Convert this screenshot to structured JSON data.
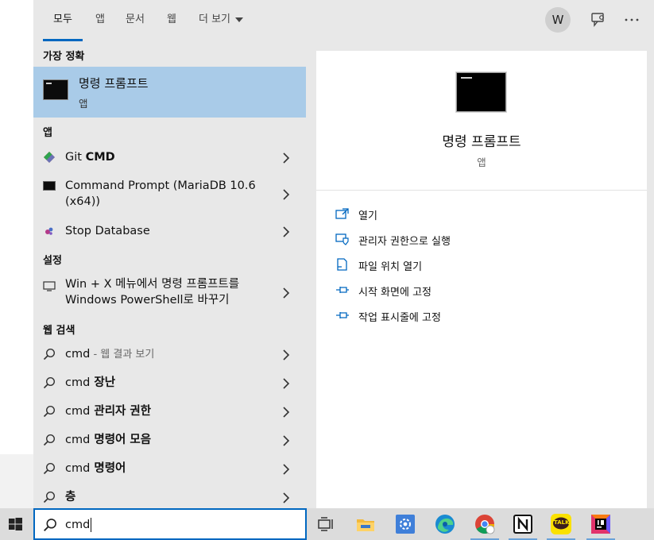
{
  "tabs": [
    {
      "label": "모두"
    },
    {
      "label": "앱"
    },
    {
      "label": "문서"
    },
    {
      "label": "웹"
    },
    {
      "label": "더 보기"
    }
  ],
  "header": {
    "avatar_letter": "W",
    "feedback_icon": "feedback-icon",
    "more_icon": "ellipsis-icon"
  },
  "list": {
    "best_match_header": "가장 정확",
    "best_match": {
      "title": "명령 프롬프트",
      "subtitle": "앱",
      "icon": "command-prompt-icon"
    },
    "apps_header": "앱",
    "apps": [
      {
        "prefix": "Git ",
        "bold": "CMD",
        "icon": "git-icon"
      },
      {
        "line1": "Command Prompt (MariaDB 10.6",
        "line2": "(x64))",
        "icon": "console-icon"
      },
      {
        "label": "Stop Database",
        "icon": "database-icon"
      }
    ],
    "settings_header": "설정",
    "settings": [
      {
        "line1": "Win + X 메뉴에서 명령 프롬프트를",
        "line2": "Windows PowerShell로 바꾸기",
        "icon": "monitor-icon"
      }
    ],
    "web_header": "웹 검색",
    "web": [
      {
        "term": "cmd",
        "suffix": " - 웹 결과 보기",
        "icon": "search-icon"
      },
      {
        "term": "cmd",
        "bold": " 장난",
        "icon": "search-icon"
      },
      {
        "term": "cmd",
        "bold": " 관리자 권한",
        "icon": "search-icon"
      },
      {
        "term": "cmd",
        "bold": " 명령어 모음",
        "icon": "search-icon"
      },
      {
        "term": "cmd",
        "bold": " 명령어",
        "icon": "search-icon"
      },
      {
        "term": "",
        "bold": "층",
        "icon": "search-icon"
      }
    ]
  },
  "preview": {
    "title": "명령 프롬프트",
    "subtitle": "앱",
    "actions": [
      {
        "label": "열기",
        "icon": "open-icon"
      },
      {
        "label": "관리자 권한으로 실행",
        "icon": "shield-icon"
      },
      {
        "label": "파일 위치 열기",
        "icon": "file-location-icon"
      },
      {
        "label": "시작 화면에 고정",
        "icon": "pin-icon"
      },
      {
        "label": "작업 표시줄에 고정",
        "icon": "pin-icon"
      }
    ]
  },
  "taskbar": {
    "search_value": "cmd",
    "apps": [
      "task-view-icon",
      "file-explorer-icon",
      "settings-app-icon",
      "edge-icon",
      "chrome-icon",
      "notion-icon",
      "kakaotalk-icon",
      "intellij-icon"
    ],
    "kakao_label": "TALK"
  },
  "colors": {
    "accent": "#0067c0",
    "selection": "#a9cbe8",
    "panel": "#e8e8e8"
  }
}
